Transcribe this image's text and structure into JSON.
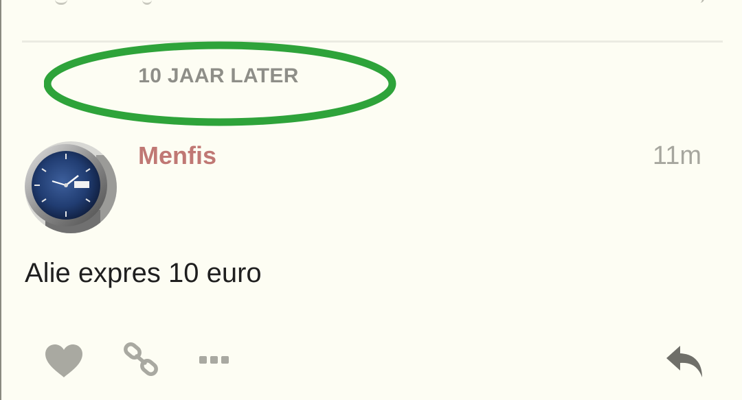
{
  "small_action": {
    "text": "10 JAAR LATER",
    "highlight_color": "#2ea33a"
  },
  "post": {
    "username": "Menfis",
    "date": "11m",
    "body": "Alie expres 10 euro",
    "avatar_icon": "watch-avatar-image",
    "username_color": "#c07874"
  },
  "actions": {
    "like_icon": "heart-icon",
    "link_icon": "link-icon",
    "more_icon": "ellipsis-icon",
    "reply_icon": "reply-icon",
    "icon_color": "#a9a9a1"
  }
}
